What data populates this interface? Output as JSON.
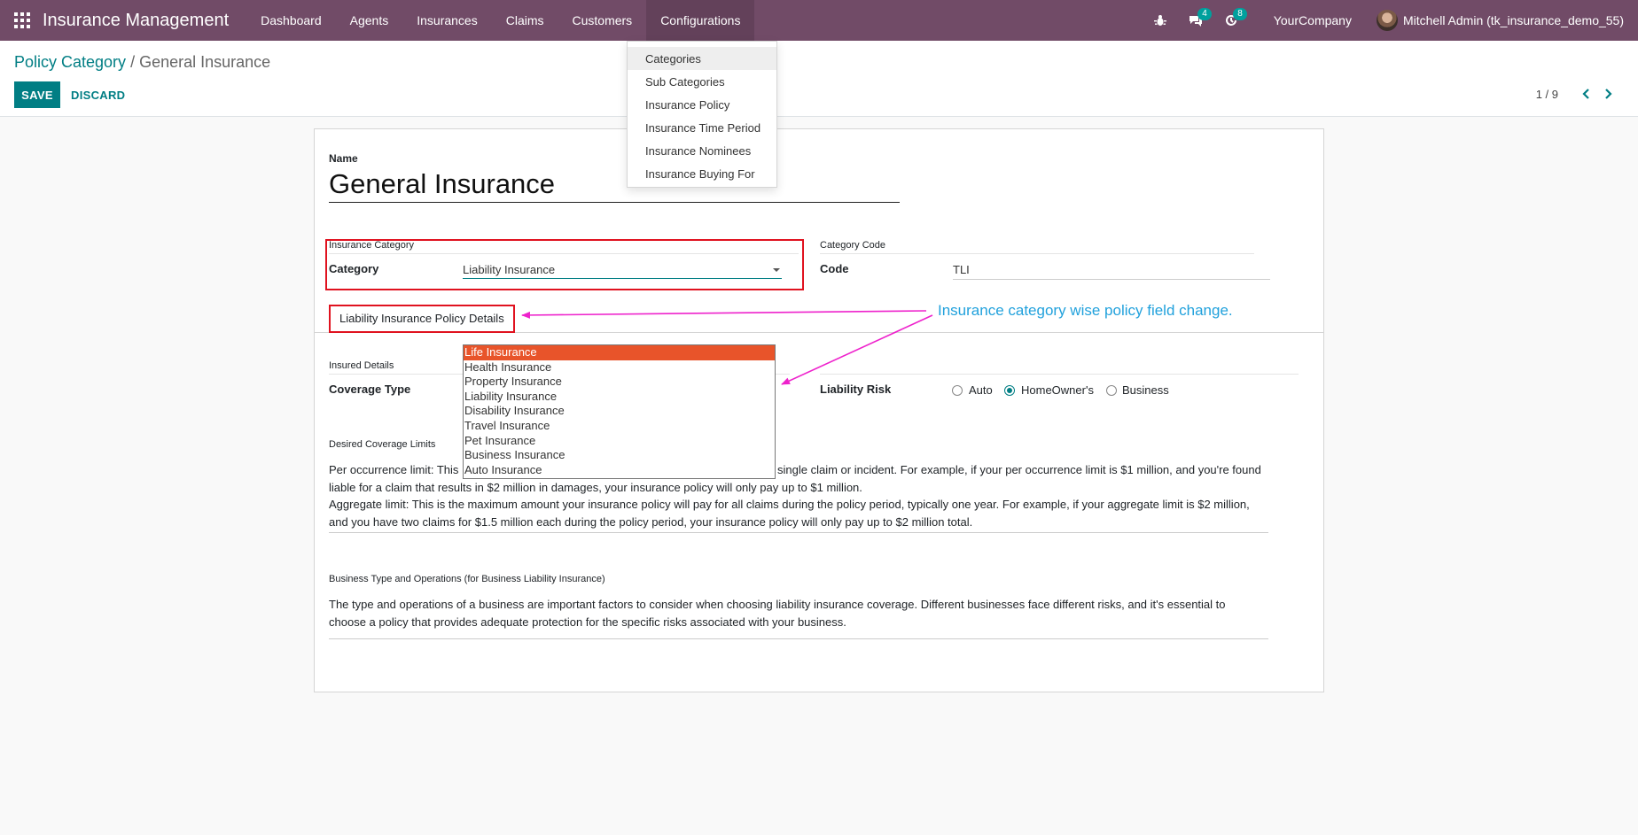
{
  "navbar": {
    "app_title": "Insurance Management",
    "menu": [
      "Dashboard",
      "Agents",
      "Insurances",
      "Claims",
      "Customers",
      "Configurations"
    ],
    "activity_badge": "4",
    "clock_badge": "8",
    "company": "YourCompany",
    "user": "Mitchell Admin (tk_insurance_demo_55)",
    "color": "#714b67"
  },
  "dropdown": {
    "items": [
      "Categories",
      "Sub Categories",
      "Insurance Policy",
      "Insurance Time Period",
      "Insurance Nominees",
      "Insurance Buying For"
    ]
  },
  "control_panel": {
    "breadcrumb_parent": "Policy Category",
    "breadcrumb_separator": "/",
    "breadcrumb_current": "General Insurance",
    "save_label": "SAVE",
    "discard_label": "DISCARD",
    "pager": "1 / 9"
  },
  "form": {
    "name_label": "Name",
    "name_value": "General Insurance",
    "insurance_category_group": "Insurance Category",
    "category_label": "Category",
    "category_value": "Liability Insurance",
    "category_code_group": "Category Code",
    "code_label": "Code",
    "code_value": "TLI",
    "tab_label": "Liability Insurance Policy Details",
    "insured_details_group": "Insured Details",
    "coverage_type_label": "Coverage Type",
    "liability_risk_label": "Liability Risk",
    "liability_risk_options": [
      "Auto",
      "HomeOwner's",
      "Business"
    ],
    "liability_risk_selected": "HomeOwner's",
    "desired_limits_label": "Desired Coverage Limits",
    "desired_limits_line1a": "Per occurrence limit: This",
    "desired_limits_line1b": "single claim or incident. For example, if your per occurrence limit is $1 million, and you're found",
    "desired_limits_line2": "liable for a claim that results in $2 million in damages, your insurance policy will only pay up to $1 million.",
    "desired_limits_line3": "Aggregate limit: This is the maximum amount your insurance policy will pay for all claims during the policy period, typically one year. For example, if your aggregate limit is $2 million,",
    "desired_limits_line4": "and you have two claims for $1.5 million each during the policy period, your insurance policy will only pay up to $2 million total.",
    "business_type_label": "Business Type and Operations (for Business Liability Insurance)",
    "business_type_line1": "The type and operations of a business are important factors to consider when choosing liability insurance coverage. Different businesses face different risks, and it's essential to",
    "business_type_line2": "choose a policy that provides adequate protection for the specific risks associated with your business."
  },
  "category_options": [
    "Life Insurance",
    "Health Insurance",
    "Property Insurance",
    "Liability Insurance",
    "Disability Insurance",
    "Travel Insurance",
    "Pet Insurance",
    "Business Insurance",
    "Auto Insurance"
  ],
  "category_options_highlighted": "Life Insurance",
  "annotation": {
    "text": "Insurance category wise policy field change.",
    "color": "#21a1dc",
    "arrow_color": "#ee22cc"
  }
}
